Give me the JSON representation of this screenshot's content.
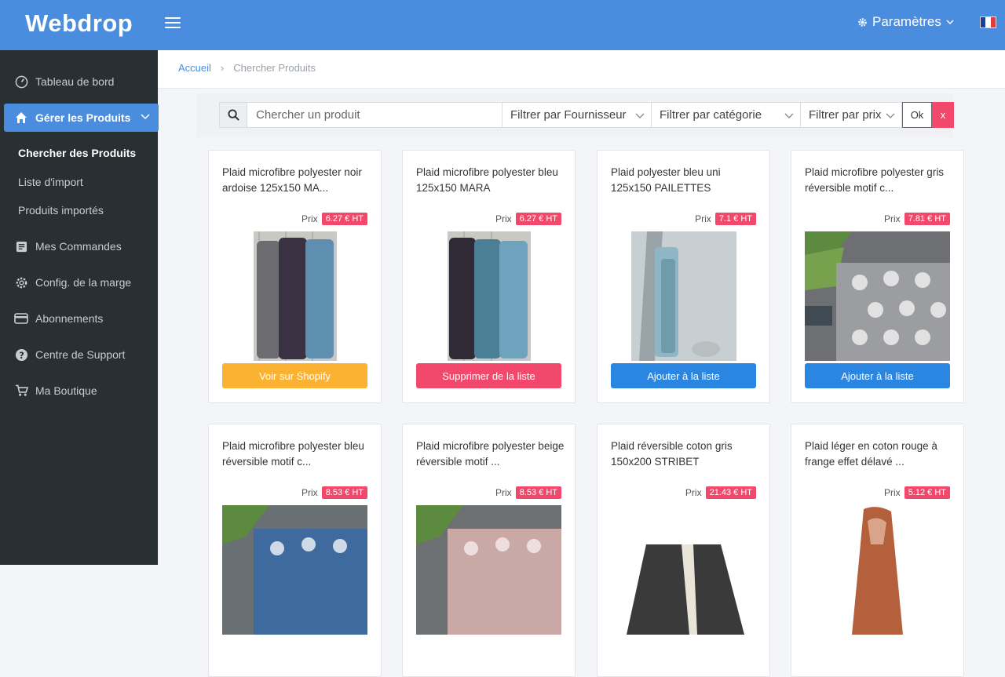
{
  "header": {
    "logo": "Webdrop",
    "settings_label": "Paramètres",
    "flag_colors": [
      "#1f3f95",
      "#ffffff",
      "#e23c3f"
    ]
  },
  "sidebar": {
    "items": [
      {
        "label": "Tableau de bord",
        "icon": "dashboard-icon"
      },
      {
        "label": "Gérer les Produits",
        "icon": "home-icon"
      },
      {
        "label": "Mes Commandes",
        "icon": "orders-icon"
      },
      {
        "label": "Config. de la marge",
        "icon": "gear-icon"
      },
      {
        "label": "Abonnements",
        "icon": "card-icon"
      },
      {
        "label": "Centre de Support",
        "icon": "help-icon"
      },
      {
        "label": "Ma Boutique",
        "icon": "cart-icon"
      }
    ],
    "subitems": [
      {
        "label": "Chercher des Produits"
      },
      {
        "label": "Liste d'import"
      },
      {
        "label": "Produits importés"
      }
    ]
  },
  "breadcrumb": {
    "home": "Accueil",
    "current": "Chercher Produits"
  },
  "search": {
    "placeholder": "Chercher un produit",
    "supplier": "Filtrer par Fournisseur",
    "category": "Filtrer par catégorie",
    "price": "Filtrer par prix",
    "ok": "Ok",
    "clear": "x"
  },
  "price_label": "Prix",
  "products": [
    {
      "title": "Plaid microfibre polyester noir ardoise 125x150 MA...",
      "price": "6.27 € HT",
      "action": "Voir sur Shopify",
      "color": "#fbb233"
    },
    {
      "title": "Plaid microfibre polyester bleu 125x150 MARA",
      "price": "6.27 € HT",
      "action": "Supprimer de la liste",
      "color": "#f2486b"
    },
    {
      "title": "Plaid polyester bleu uni 125x150 PAILETTES",
      "price": "7.1 € HT",
      "action": "Ajouter à la liste",
      "color": "#2b86e2"
    },
    {
      "title": "Plaid microfibre polyester gris réversible motif c...",
      "price": "7.81 € HT",
      "action": "Ajouter à la liste",
      "color": "#2b86e2"
    },
    {
      "title": "Plaid microfibre polyester bleu réversible motif c...",
      "price": "8.53 € HT"
    },
    {
      "title": "Plaid microfibre polyester beige réversible motif ...",
      "price": "8.53 € HT"
    },
    {
      "title": "Plaid réversible coton gris 150x200 STRIBET",
      "price": "21.43 € HT"
    },
    {
      "title": "Plaid léger en coton rouge à frange effet délavé ...",
      "price": "5.12 € HT"
    }
  ]
}
